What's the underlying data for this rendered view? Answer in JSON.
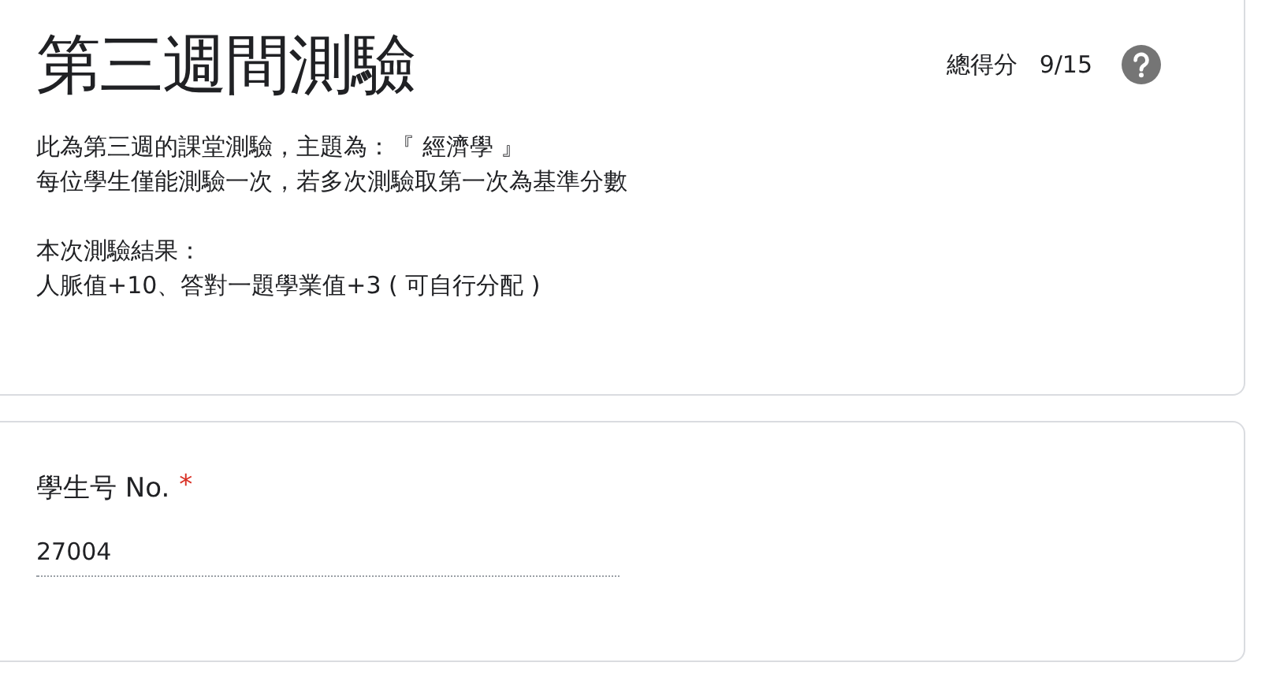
{
  "header": {
    "title": "第三週間測驗",
    "score_label": "總得分",
    "score": "9/15",
    "paragraphs": [
      [
        "此為第三週的課堂測驗，主題為：『 經濟學 』",
        "每位學生僅能測驗一次，若多次測驗取第一次為基準分數"
      ],
      [
        "本次測驗結果：",
        "人脈值+10、答對一題學業值+3 ( 可自行分配 )"
      ]
    ]
  },
  "question": {
    "label": "學生号 No.",
    "required_mark": "*",
    "value": "27004",
    "disabled": true
  }
}
